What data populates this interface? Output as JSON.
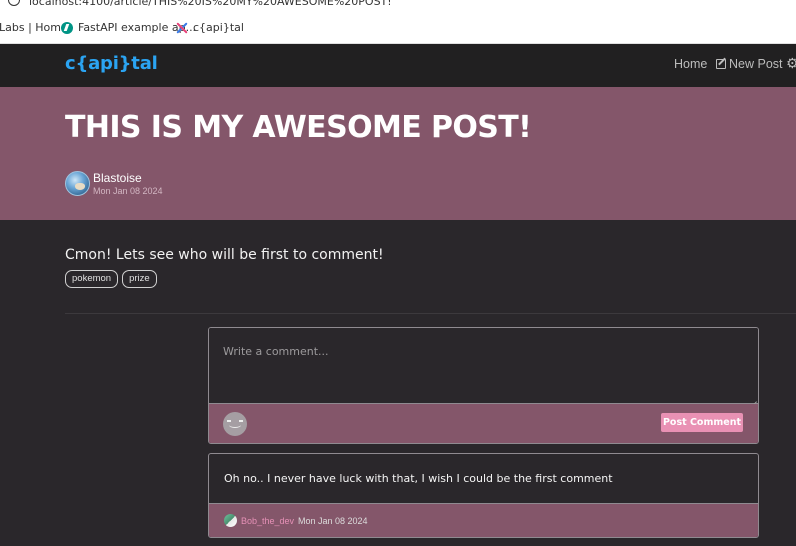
{
  "browser": {
    "url": "localhost:4100/article/THIS%20IS%20MY%20AWESOME%20POST!",
    "bookmarks": [
      {
        "label": "Labs | Home"
      },
      {
        "label": "FastAPI example ap..."
      },
      {
        "label": "c{api}tal"
      }
    ]
  },
  "navbar": {
    "brand": "c{api}tal",
    "home": "Home",
    "new_post": "New Post"
  },
  "article": {
    "title": "THIS IS MY AWESOME POST!",
    "author": "Blastoise",
    "date": "Mon Jan 08 2024",
    "body": "Cmon! Lets see who will be first to comment!",
    "tags": [
      "pokemon",
      "prize"
    ]
  },
  "comment_form": {
    "placeholder": "Write a comment...",
    "submit_label": "Post Comment"
  },
  "comments": [
    {
      "text": "Oh no.. I never have luck with that, I wish I could be the first comment",
      "author": "Bob_the_dev",
      "date": "Mon Jan 08 2024"
    }
  ],
  "colors": {
    "banner": "#84566a",
    "brand": "#2ba4f2",
    "button": "#e991b4",
    "author_link": "#e590b6"
  }
}
